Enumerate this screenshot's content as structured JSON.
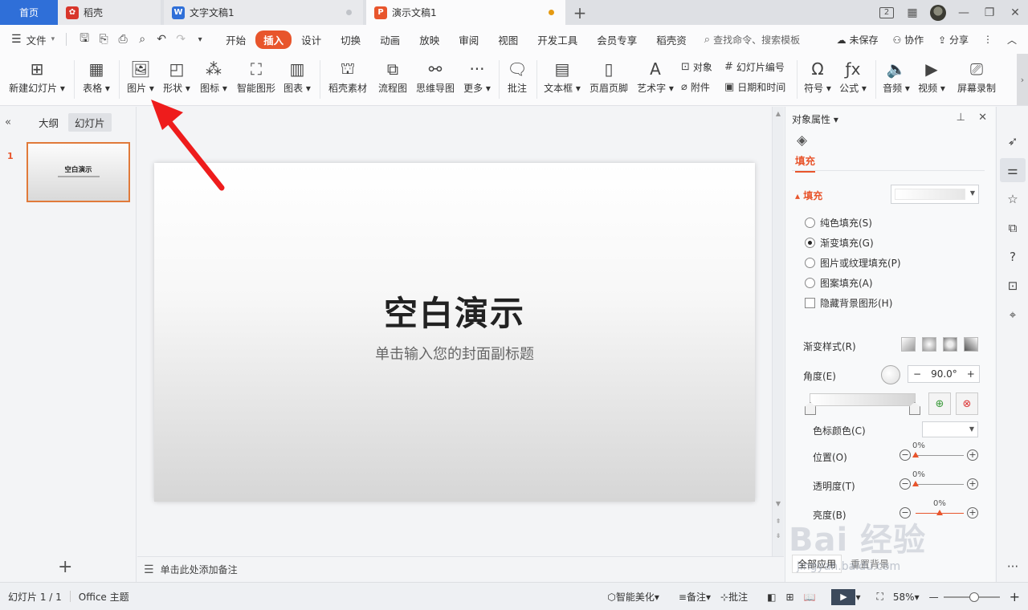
{
  "tabs": {
    "home": "首页",
    "docer": "稻壳",
    "doc": "文字文稿1",
    "ppt": "演示文稿1",
    "badge": "2"
  },
  "menu": {
    "file": "文件",
    "tabs": [
      "开始",
      "插入",
      "设计",
      "切换",
      "动画",
      "放映",
      "审阅",
      "视图",
      "开发工具",
      "会员专享",
      "稻壳资"
    ],
    "search_placeholder": "查找命令、搜索模板",
    "unsaved": "未保存",
    "collab": "协作",
    "share": "分享"
  },
  "ribbon": {
    "new_slide": "新建幻灯片",
    "table": "表格",
    "picture": "图片",
    "shape": "形状",
    "icon": "图标",
    "smartart": "智能图形",
    "chart": "图表",
    "docer_material": "稻壳素材",
    "flowchart": "流程图",
    "mindmap": "思维导图",
    "more": "更多",
    "comment": "批注",
    "textbox": "文本框",
    "header_footer": "页眉页脚",
    "wordart": "艺术字",
    "object": "对象",
    "slide_number": "幻灯片编号",
    "attachment": "附件",
    "datetime": "日期和时间",
    "symbol": "符号",
    "formula": "公式",
    "audio": "音频",
    "video": "视频",
    "screen_record": "屏幕录制"
  },
  "left_panel": {
    "outline": "大纲",
    "slides": "幻灯片",
    "slide_num": "1",
    "thumb_title": "空白演示"
  },
  "slide": {
    "title": "空白演示",
    "subtitle": "单击输入您的封面副标题"
  },
  "notes": "单击此处添加备注",
  "props": {
    "header": "对象属性",
    "tab_fill": "填充",
    "section_fill": "填充",
    "options": [
      "纯色填充(S)",
      "渐变填充(G)",
      "图片或纹理填充(P)",
      "图案填充(A)"
    ],
    "hide_bg": "隐藏背景图形(H)",
    "gradient_style": "渐变样式(R)",
    "angle": "角度(E)",
    "angle_value": "90.0°",
    "stop_color": "色标颜色(C)",
    "position": "位置(O)",
    "position_value": "0%",
    "transparency": "透明度(T)",
    "transparency_value": "0%",
    "brightness": "亮度(B)",
    "brightness_value": "0%",
    "apply_all": "全部应用",
    "reset_bg": "重置背景"
  },
  "status": {
    "slide_count": "幻灯片 1 / 1",
    "theme": "Office 主题",
    "beautify": "智能美化",
    "notes": "备注",
    "comment": "批注",
    "zoom": "58%"
  },
  "watermark": {
    "main": "Bai 经验",
    "url": "jingyan.baidu.com"
  },
  "colors": {
    "accent": "#e8552c",
    "home_tab": "#2f6fd8"
  }
}
